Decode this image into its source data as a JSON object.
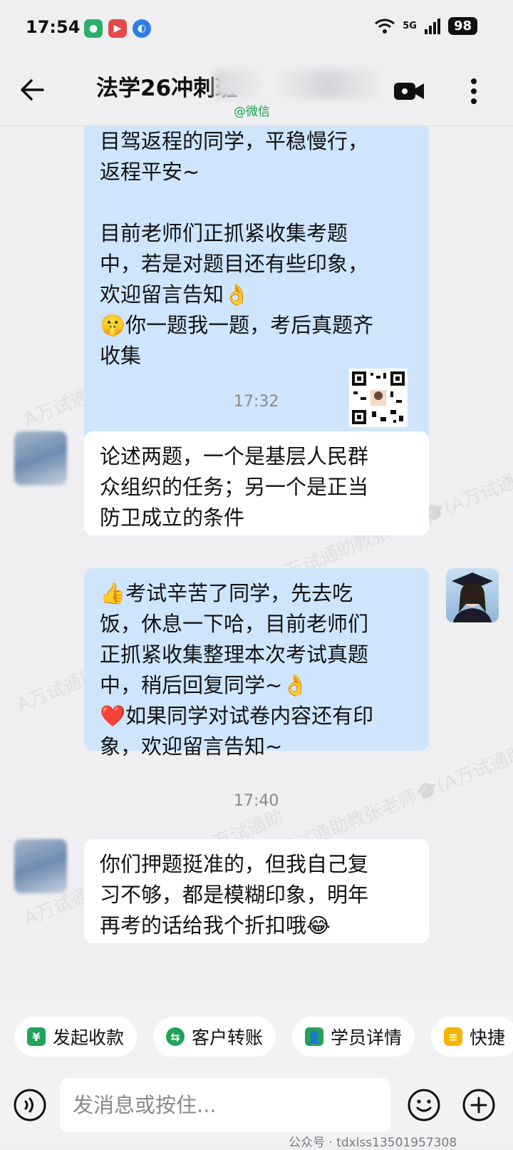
{
  "status_bar": {
    "time": "17:54",
    "network": "5G",
    "battery": "98"
  },
  "header": {
    "title": "法学26冲刺班 ",
    "subtitle": "@微信"
  },
  "messages": {
    "m1_lines": [
      "目驾返程的同学，平稳慢行，",
      "返程平安~",
      "",
      "目前老师们正抓紧收集考题",
      "中，若是对题目还有些印象，",
      "欢迎留言告知👌",
      "🤫你一题我一题，考后真题齐",
      "收集"
    ],
    "time1": "17:32",
    "m2_lines": [
      "论述两题，一个是基层人民群",
      "众组织的任务；另一个是正当",
      "防卫成立的条件"
    ],
    "m3_lines": [
      "👍考试辛苦了同学，先去吃",
      "饭，休息一下哈，目前老师们",
      "正抓紧收集整理本次考试真题",
      "中，稍后回复同学~👌",
      "❤️如果同学对试卷内容还有印",
      "象，欢迎留言告知~"
    ],
    "time2": "17:40",
    "m4_lines": [
      "你们押题挺准的，但我自己复",
      "习不够，都是模糊印象，明年",
      "再考的话给我个折扣哦😂"
    ]
  },
  "watermark_text": "A万试通助教张老师🎓(A万试通助",
  "quick_actions": [
    "发起收款",
    "客户转账",
    "学员详情",
    "快捷"
  ],
  "input": {
    "placeholder": "发消息或按住..."
  },
  "footer": {
    "watermark": "公众号 · tdxlss13501957308"
  },
  "colors": {
    "bubble_out": "#cfe5fc",
    "bubble_in": "#ffffff",
    "accent_green": "#16a34a",
    "background": "#efeff2"
  },
  "icons": [
    "back-arrow-icon",
    "video-call-icon",
    "more-icon",
    "wechat-icon",
    "voice-icon",
    "emoji-icon",
    "plus-icon"
  ]
}
